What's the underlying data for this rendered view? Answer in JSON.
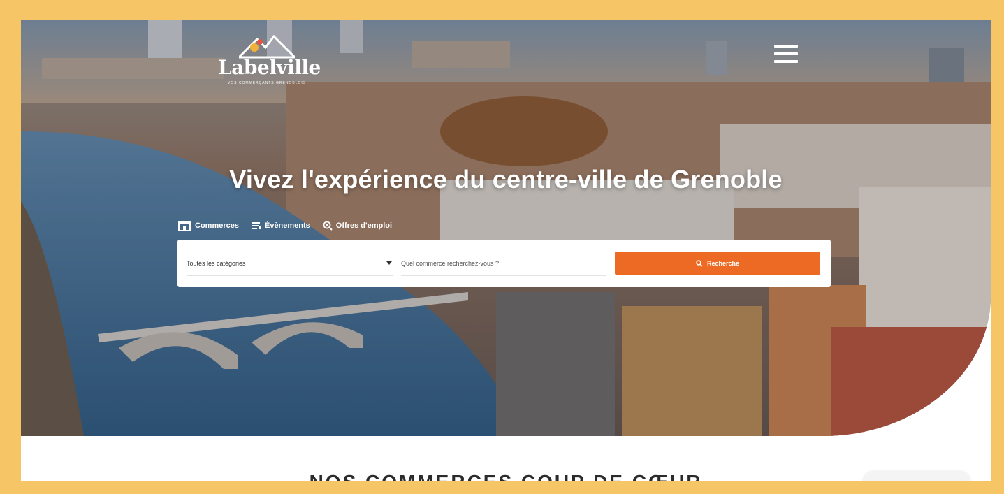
{
  "brand": {
    "name": "Labelville",
    "tagline": "VOS COMMERÇANTS GRENOBLOIS"
  },
  "hero": {
    "headline": "Vivez l'expérience du centre-ville de Grenoble"
  },
  "tabs": [
    {
      "label": "Commerces",
      "icon": "storefront-icon"
    },
    {
      "label": "Évènements",
      "icon": "events-list-icon"
    },
    {
      "label": "Offres d'emploi",
      "icon": "job-search-icon"
    }
  ],
  "search": {
    "category_value": "Toutes les catégories",
    "query_placeholder": "Quel commerce recherchez-vous ?",
    "button_label": "Recherche"
  },
  "sections": {
    "favorites_title": "NOS COMMERCES COUP DE CŒUR"
  },
  "colors": {
    "frame": "#f6c566",
    "accent": "#ec6a23",
    "text_light": "#ffffff"
  }
}
